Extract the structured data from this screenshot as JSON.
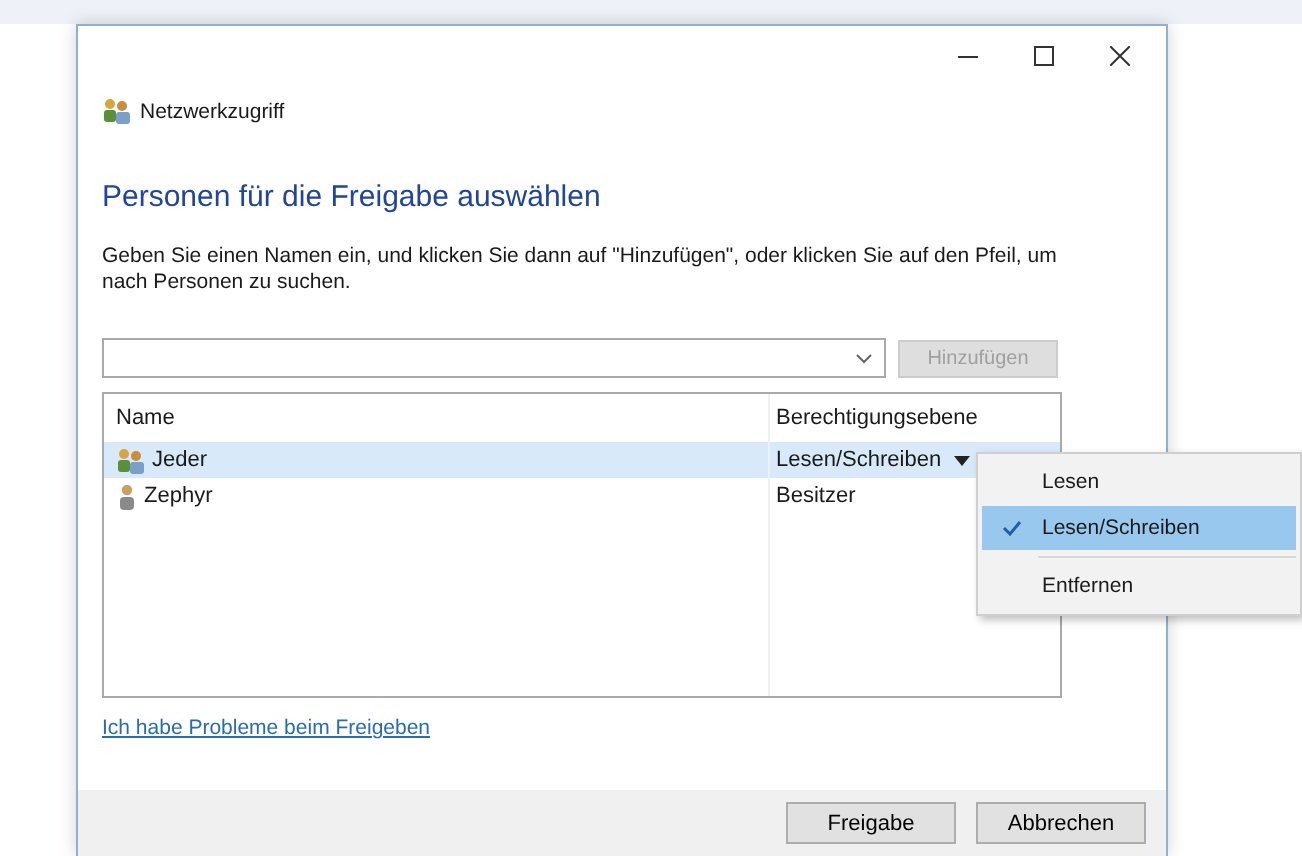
{
  "window": {
    "title": "Netzwerkzugriff"
  },
  "heading": "Personen für die Freigabe auswählen",
  "instructions": "Geben Sie einen Namen ein, und klicken Sie dann auf \"Hinzufügen\", oder klicken Sie auf den Pfeil, um nach Personen zu suchen.",
  "add_button": {
    "label": "Hinzufügen",
    "disabled": true
  },
  "list": {
    "columns": [
      "Name",
      "Berechtigungsebene"
    ],
    "rows": [
      {
        "name": "Jeder",
        "permission": "Lesen/Schreiben",
        "kind": "group",
        "selected": true
      },
      {
        "name": "Zephyr",
        "permission": "Besitzer",
        "kind": "user",
        "selected": false
      }
    ]
  },
  "menu": {
    "items": [
      {
        "label": "Lesen",
        "kind": "option",
        "checked": false,
        "selected": false
      },
      {
        "label": "Lesen/Schreiben",
        "kind": "option",
        "checked": true,
        "selected": true
      },
      {
        "label": "Entfernen",
        "kind": "action",
        "checked": false,
        "selected": false
      }
    ]
  },
  "help_link": "Ich habe Probleme beim Freigeben",
  "buttons": [
    "Freigabe",
    "Abbrechen"
  ]
}
